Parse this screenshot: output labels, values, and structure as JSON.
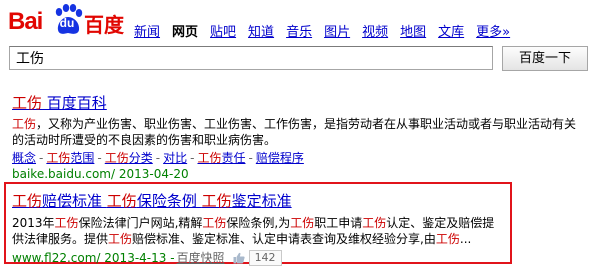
{
  "logo": {
    "part1": "Bai",
    "paw": "du",
    "part2": "百度"
  },
  "nav": [
    "新闻",
    "网页",
    "贴吧",
    "知道",
    "音乐",
    "图片",
    "视频",
    "地图",
    "文库",
    "更多»"
  ],
  "nav_active_index": 1,
  "search": {
    "value": "工伤",
    "button_label": "百度一下"
  },
  "results": [
    {
      "title": [
        "工伤",
        " 百度百科"
      ],
      "abstract": [
        {
          "t": "工伤",
          "em": true
        },
        {
          "t": "，又称为产业伤害、职业伤害、工业伤害、工作伤害，是指劳动者在从事职业活动或者与职业活动有关的活动时所遭受的不良因素的伤害和职业病伤害。",
          "em": false
        }
      ],
      "links": [
        [
          {
            "t": "概念",
            "em": false
          }
        ],
        [
          {
            "t": "工伤",
            "em": true
          },
          {
            "t": "范围",
            "em": false
          }
        ],
        [
          {
            "t": "工伤",
            "em": true
          },
          {
            "t": "分类",
            "em": false
          }
        ],
        [
          {
            "t": "对比",
            "em": false
          }
        ],
        [
          {
            "t": "工伤",
            "em": true
          },
          {
            "t": "责任",
            "em": false
          }
        ],
        [
          {
            "t": "赔偿程序",
            "em": false
          }
        ]
      ],
      "link_sep": "-",
      "url": "baike.baidu.com/ 2013-04-20"
    },
    {
      "title": [
        "工伤",
        "赔偿标准 ",
        "工伤",
        "保险条例 ",
        "工伤",
        "鉴定标准"
      ],
      "abstract": [
        {
          "t": "2013年",
          "em": false
        },
        {
          "t": "工伤",
          "em": true
        },
        {
          "t": "保险法律门户网站,精解",
          "em": false
        },
        {
          "t": "工伤",
          "em": true
        },
        {
          "t": "保险条例,为",
          "em": false
        },
        {
          "t": "工伤",
          "em": true
        },
        {
          "t": "职工申请",
          "em": false
        },
        {
          "t": "工伤",
          "em": true
        },
        {
          "t": "认定、鉴定及赔偿提供法律服务。提供",
          "em": false
        },
        {
          "t": "工伤",
          "em": true
        },
        {
          "t": "赔偿标准、鉴定标准、认定申请表查询及维权经验分享,由",
          "em": false
        },
        {
          "t": "工伤",
          "em": true
        },
        {
          "t": "...",
          "em": false
        }
      ],
      "url": "www.fl22.com/ 2013-4-13 - ",
      "cache_label": "百度快照",
      "like_count": "142"
    }
  ],
  "colors": {
    "brand_red": "#e10601",
    "link_blue": "#0000cc",
    "highlight_red": "#cc0000",
    "url_green": "#008000",
    "ad_border": "#e1141b"
  }
}
